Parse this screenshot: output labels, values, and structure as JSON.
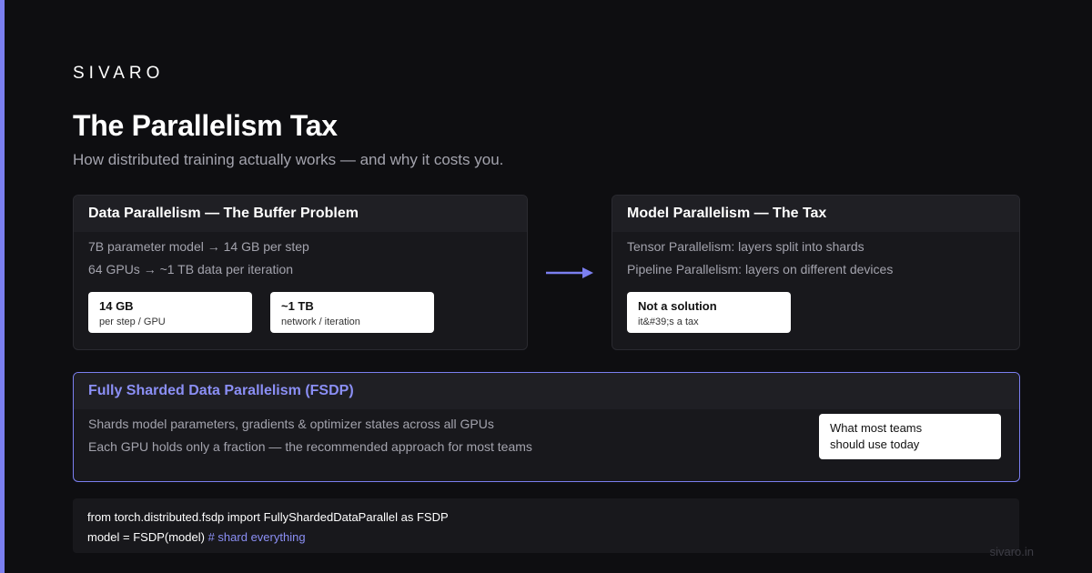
{
  "brand": "SIVARO",
  "title": "The Parallelism Tax",
  "subtitle": "How distributed training actually works — and why it costs you.",
  "colors": {
    "accent": "#7b7ff0",
    "background": "#0e0e11",
    "card": "#18181c"
  },
  "data_card": {
    "heading": "Data Parallelism — The Buffer Problem",
    "lines": [
      "7B parameter model → 14 GB per step",
      "64 GPUs → ~1 TB data per iteration"
    ],
    "stats": [
      {
        "value": "14 GB",
        "label": "per step / GPU"
      },
      {
        "value": "~1 TB",
        "label": "network / iteration"
      }
    ]
  },
  "arrow_icon": "arrow-right-icon",
  "model_card": {
    "heading": "Model Parallelism — The Tax",
    "lines": [
      "Tensor Parallelism: layers split into shards",
      "Pipeline Parallelism: layers on different devices"
    ],
    "stat": {
      "value": "Not a solution",
      "label": "it&#39;s a tax"
    }
  },
  "fsdp_card": {
    "heading": "Fully Sharded Data Parallelism (FSDP)",
    "lines": [
      "Shards model parameters, gradients & optimizer states across all GPUs",
      "Each GPU holds only a fraction — the recommended approach for most teams"
    ],
    "note_line1": "What most teams",
    "note_line2": "should use today"
  },
  "code": {
    "line1": "from torch.distributed.fsdp import FullyShardedDataParallel as FSDP",
    "line2_code": "model = FSDP(model)",
    "line2_comment": "# shard everything"
  },
  "footer": "sivaro.in"
}
